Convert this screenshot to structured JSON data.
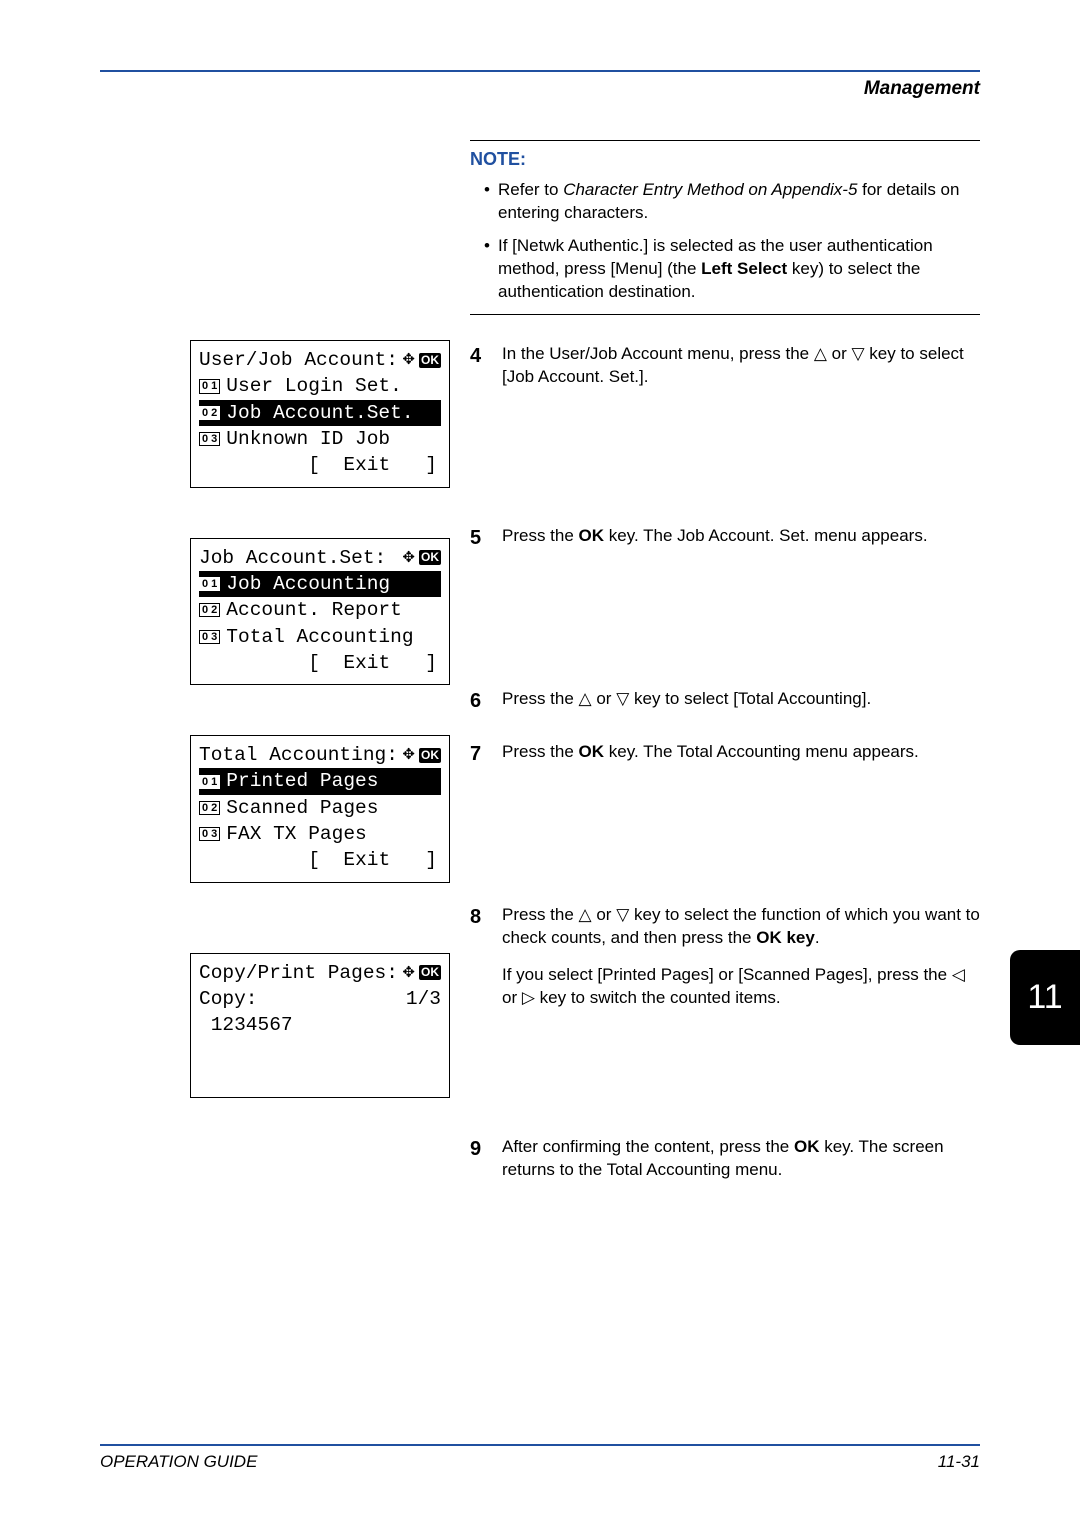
{
  "header": {
    "section": "Management"
  },
  "note": {
    "title": "NOTE:",
    "items": [
      {
        "pre": "Refer to ",
        "ital": "Character Entry Method on Appendix-5",
        "post": " for details on entering characters."
      },
      {
        "full": "If [Netwk Authentic.] is selected as the user authentication method, press [Menu] (the ",
        "bold": "Left Select",
        "post": " key) to select the authentication destination."
      }
    ]
  },
  "steps": {
    "s4": {
      "num": "4",
      "text_pre": "In the User/Job Account menu, press the ",
      "tri1": "△",
      "mid": " or ",
      "tri2": "▽",
      "text_post": " key to select [Job Account. Set.]."
    },
    "s5": {
      "num": "5",
      "pre": "Press the ",
      "bold": "OK",
      "post": " key. The Job Account. Set. menu appears."
    },
    "s6": {
      "num": "6",
      "pre": "Press the ",
      "tri1": "△",
      "mid": " or ",
      "tri2": "▽",
      "post": " key to select [Total Accounting]."
    },
    "s7": {
      "num": "7",
      "pre": "Press the ",
      "bold": "OK",
      "post": " key. The Total Accounting menu appears."
    },
    "s8": {
      "num": "8",
      "p1_pre": "Press the ",
      "p1_tri1": "△",
      "p1_mid": " or ",
      "p1_tri2": "▽",
      "p1_post": " key to select the function of which you want to check counts, and then press the ",
      "p1_bold": "OK key",
      "p1_end": ".",
      "p2_pre": "If you select [Printed Pages] or [Scanned Pages], press the ",
      "p2_tri1": "◁",
      "p2_mid": " or ",
      "p2_tri2": "▷",
      "p2_post": " key to switch the counted items."
    },
    "s9": {
      "num": "9",
      "pre": "After confirming the content, press the ",
      "bold": "OK",
      "post": " key. The screen returns to the Total Accounting menu."
    }
  },
  "lcd1": {
    "title": "User/Job Account:",
    "r1": {
      "n": "0 1",
      "t": "User Login Set."
    },
    "r2": {
      "n": "0 2",
      "t": "Job Account.Set."
    },
    "r3": {
      "n": "0 3",
      "t": "Unknown ID Job"
    },
    "exit": "[  Exit   ]"
  },
  "lcd2": {
    "title": "Job Account.Set:",
    "r1": {
      "n": "0 1",
      "t": "Job Accounting"
    },
    "r2": {
      "n": "0 2",
      "t": "Account. Report"
    },
    "r3": {
      "n": "0 3",
      "t": "Total Accounting"
    },
    "exit": "[  Exit   ]"
  },
  "lcd3": {
    "title": "Total Accounting:",
    "r1": {
      "n": "0 1",
      "t": "Printed Pages"
    },
    "r2": {
      "n": "0 2",
      "t": "Scanned Pages"
    },
    "r3": {
      "n": "0 3",
      "t": "FAX TX Pages"
    },
    "exit": "[  Exit   ]"
  },
  "lcd4": {
    "title": "Copy/Print Pages:",
    "label": "Copy:",
    "pager": "1/3",
    "value": " 1234567"
  },
  "icons": {
    "ok": "OK",
    "updown": "✥",
    "allarrows": "✥"
  },
  "tab": {
    "num": "11"
  },
  "footer": {
    "left": "OPERATION GUIDE",
    "right": "11-31"
  }
}
